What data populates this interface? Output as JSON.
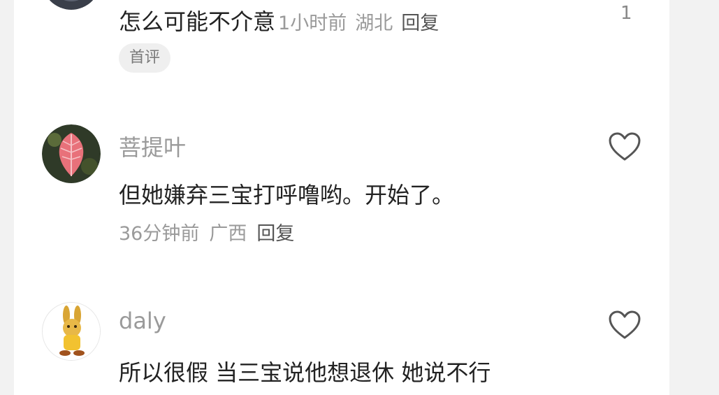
{
  "comments": [
    {
      "text": "怎么可能不介意",
      "time": "1小时前",
      "location": "湖北",
      "reply_label": "回复",
      "like_count": "1",
      "badge": "首评",
      "avatar": "dark-avatar"
    },
    {
      "username": "菩提叶",
      "text": "但她嫌弃三宝打呼噜哟。开始了。",
      "time": "36分钟前",
      "location": "广西",
      "reply_label": "回复",
      "avatar": "red-bodhi-leaf"
    },
    {
      "username": "daly",
      "text": "所以很假 当三宝说他想退休 她说不行",
      "avatar": "yellow-cartoon-rabbit"
    }
  ],
  "icons": {
    "like": "heart-outline-icon"
  },
  "colors": {
    "panel_bg": "#ffffff",
    "page_bg": "#f2f2f2",
    "text_primary": "#222222",
    "text_secondary": "#9a9a9a",
    "badge_bg": "#efefef"
  }
}
